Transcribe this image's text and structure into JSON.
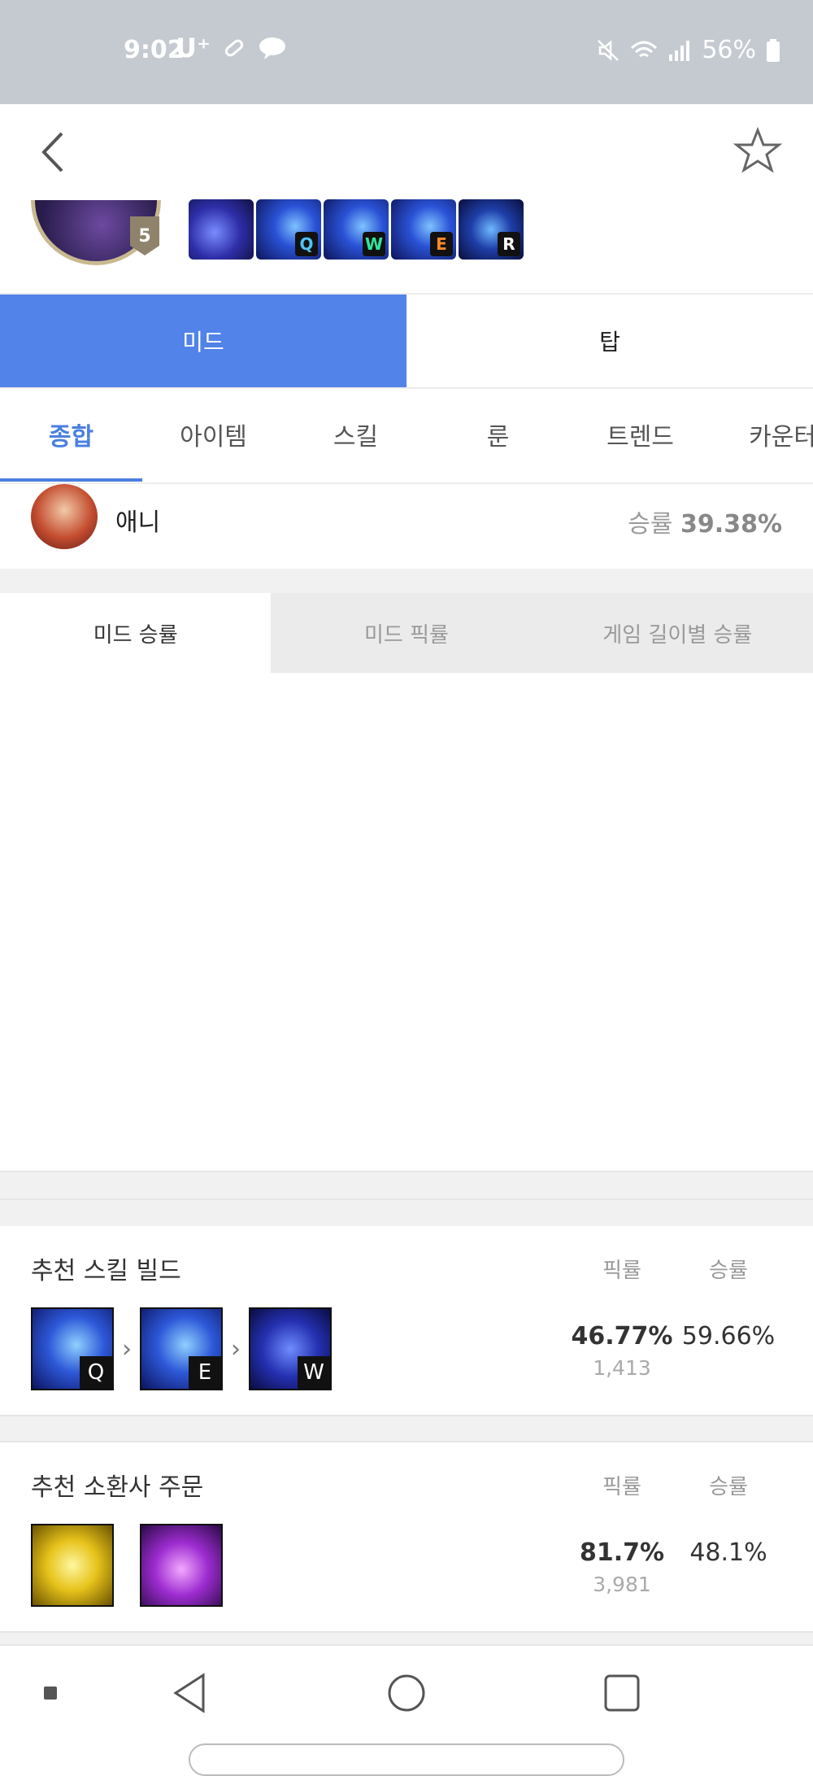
{
  "status_bar": {
    "time": "9:02",
    "carrier": "U⁺",
    "battery": "56%",
    "icons": [
      "pill-icon",
      "talk-icon",
      "mute-icon",
      "wifi-icon",
      "signal-icon",
      "battery-icon"
    ]
  },
  "header": {
    "champion_level": "5",
    "skill_keys": [
      "Q",
      "W",
      "E",
      "R"
    ]
  },
  "position_tabs": [
    {
      "label": "미드",
      "active": true
    },
    {
      "label": "탑",
      "active": false
    }
  ],
  "section_tabs": [
    {
      "label": "종합",
      "active": true
    },
    {
      "label": "아이템",
      "active": false
    },
    {
      "label": "스킬",
      "active": false
    },
    {
      "label": "룬",
      "active": false
    },
    {
      "label": "트렌드",
      "active": false
    },
    {
      "label": "카운터",
      "active": false
    }
  ],
  "counter": {
    "name": "애니",
    "winrate_label": "승률",
    "winrate_value": "39.38%"
  },
  "graph_tabs": [
    {
      "label": "미드 승률",
      "active": true
    },
    {
      "label": "미드 픽률",
      "active": false
    },
    {
      "label": "게임 길이별 승률",
      "active": false
    }
  ],
  "skill_build": {
    "title": "추천 스킬 빌드",
    "pick_header": "픽률",
    "win_header": "승률",
    "order": [
      "Q",
      "E",
      "W"
    ],
    "pick_rate": "46.77%",
    "games": "1,413",
    "win_rate": "59.66%"
  },
  "summoner_spells": {
    "title": "추천 소환사 주문",
    "pick_header": "픽률",
    "win_header": "승률",
    "spells": [
      "flash-spell-icon",
      "ignite-spell-icon"
    ],
    "pick_rate": "81.7%",
    "games": "3,981",
    "win_rate": "48.1%"
  },
  "colors": {
    "accent": "#5183e8",
    "tab_active_text": "#4a7fe0",
    "status_bar": "#c5cad1"
  }
}
